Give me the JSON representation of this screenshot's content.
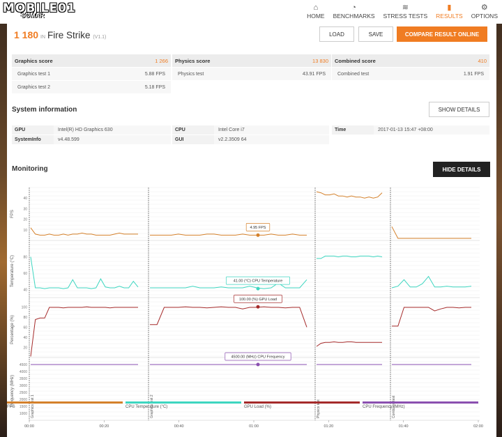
{
  "brand": {
    "logo": "MOBILE",
    "logo_sub": "01",
    "logo_sub2": "SOMAR"
  },
  "nav": [
    {
      "icon": "home-icon",
      "glyph": "⌂",
      "label": "HOME",
      "active": false
    },
    {
      "icon": "gauge-icon",
      "glyph": "◔",
      "label": "BENCHMARKS",
      "active": false
    },
    {
      "icon": "stress-icon",
      "glyph": "≋",
      "label": "STRESS TESTS",
      "active": false
    },
    {
      "icon": "bar-chart-icon",
      "glyph": "▮",
      "label": "RESULTS",
      "active": true
    },
    {
      "icon": "gear-icon",
      "glyph": "⚙",
      "label": "OPTIONS",
      "active": false
    }
  ],
  "result": {
    "score": "1 180",
    "in": "IN",
    "test": "Fire Strike",
    "version": "(V1.1)"
  },
  "buttons": {
    "load": "LOAD",
    "save": "SAVE",
    "compare": "COMPARE RESULT ONLINE",
    "show_details": "SHOW DETAILS",
    "hide_details": "HIDE DETAILS"
  },
  "scores": [
    {
      "title": "Graphics score",
      "value": "1 266",
      "rows": [
        {
          "k": "Graphics test 1",
          "v": "5.88 FPS"
        },
        {
          "k": "Graphics test 2",
          "v": "5.18 FPS"
        }
      ]
    },
    {
      "title": "Physics score",
      "value": "13 830",
      "rows": [
        {
          "k": "Physics test",
          "v": "43.91 FPS"
        }
      ]
    },
    {
      "title": "Combined score",
      "value": "410",
      "rows": [
        {
          "k": "Combined test",
          "v": "1.91 FPS"
        }
      ]
    }
  ],
  "system": {
    "title": "System information",
    "gpu_label": "GPU",
    "gpu": "Intel(R) HD Graphics 630",
    "sysinfo_label": "SystemInfo",
    "sysinfo": "v4.48.599",
    "cpu_label": "CPU",
    "cpu": "Intel Core i7",
    "gui_label": "GUI",
    "gui": "v2.2.3509 64",
    "time_label": "Time",
    "time": "2017-01-13 15:47 +08:00"
  },
  "monitoring": {
    "title": "Monitoring"
  },
  "colors": {
    "accent": "#f07c22",
    "fps": "#d4802a",
    "temp": "#3dd6c0",
    "gpu": "#a52a2a",
    "freq": "#8a4fb0"
  },
  "chart_data": {
    "type": "line",
    "x_ticks": [
      "00:00",
      "00:20",
      "00:40",
      "01:00",
      "01:20",
      "01:40",
      "02:00"
    ],
    "segment_labels": [
      "Graphics test 1",
      "Graphics test 2",
      "Physics test",
      "Combined test"
    ],
    "series": [
      {
        "name": "FPS",
        "ylabel": "FPS",
        "yticks": [
          "10",
          "20",
          "30",
          "40"
        ],
        "ylim": [
          0,
          50
        ],
        "tooltip": "4.95 FPS",
        "values": [
          [
            12,
            6,
            5,
            5,
            6,
            5,
            5,
            6,
            5,
            6,
            6,
            7,
            6,
            6,
            5,
            5,
            5,
            5,
            6,
            7,
            6,
            6,
            6,
            6
          ],
          [
            5,
            5,
            5,
            5,
            6,
            5,
            5,
            5,
            6,
            6,
            5,
            5,
            5,
            6,
            5,
            5,
            5,
            6,
            5,
            5,
            6,
            5,
            5
          ],
          [
            46,
            45,
            43,
            43,
            44,
            42,
            42,
            41,
            42,
            41,
            41,
            40,
            41,
            40,
            41,
            45
          ],
          [
            13,
            2,
            2,
            2,
            2,
            2,
            2,
            2,
            2,
            2,
            2,
            2,
            2,
            2
          ]
        ]
      },
      {
        "name": "CPU Temperature (°C)",
        "ylabel": "Temperature (°C)",
        "yticks": [
          "40",
          "60",
          "80"
        ],
        "ylim": [
          30,
          95
        ],
        "tooltip": "41.00 (°C) CPU Temperature",
        "values": [
          [
            80,
            42,
            42,
            41,
            42,
            42,
            42,
            41,
            42,
            52,
            42,
            42,
            42,
            41,
            42,
            53,
            43,
            42,
            42,
            44,
            42,
            42,
            50,
            43
          ],
          [
            42,
            42,
            42,
            42,
            42,
            42,
            44,
            42,
            42,
            42,
            43,
            42,
            42,
            42,
            44,
            42,
            41,
            42,
            48,
            42,
            42,
            42,
            52
          ],
          [
            78,
            78,
            81,
            81,
            81,
            80,
            81,
            81,
            80,
            80,
            81,
            81,
            81,
            80,
            81,
            80
          ],
          [
            42,
            44,
            52,
            43,
            43,
            47,
            56,
            43,
            43,
            44,
            43,
            43,
            43,
            44
          ]
        ]
      },
      {
        "name": "GPU Load (%)",
        "ylabel": "Percentage (%)",
        "yticks": [
          "20",
          "40",
          "60",
          "80",
          "100"
        ],
        "ylim": [
          0,
          110
        ],
        "tooltip": "100.00 (%) GPU Load",
        "values": [
          [
            2,
            75,
            78,
            78,
            99,
            99,
            99,
            98,
            99,
            99,
            99,
            99,
            100,
            99,
            99,
            99,
            99,
            98,
            99,
            99,
            99,
            99,
            99,
            99
          ],
          [
            65,
            65,
            99,
            99,
            99,
            100,
            99,
            99,
            98,
            99,
            100,
            99,
            99,
            96,
            99,
            99,
            100,
            99,
            99,
            98,
            99,
            99,
            60
          ],
          [
            22,
            28,
            30,
            30,
            31,
            30,
            30,
            31,
            31,
            30,
            30,
            30,
            30,
            30,
            30,
            30
          ],
          [
            62,
            62,
            99,
            99,
            99,
            99,
            99,
            92,
            96,
            99,
            99,
            98,
            99,
            99
          ]
        ]
      },
      {
        "name": "CPU Frequency (MHz)",
        "ylabel": "Frequency (MHz)",
        "yticks": [
          "1000",
          "1500",
          "2000",
          "2500",
          "3000",
          "3500",
          "4000",
          "4500"
        ],
        "ylim": [
          500,
          4700
        ],
        "tooltip": "4500.00 (MHz) CPU Frequency",
        "values": [
          [
            4500,
            4500,
            4500,
            4500,
            4500,
            4500,
            4500,
            4500,
            4500,
            4500,
            4500,
            4500,
            4500,
            4500,
            4500,
            4500,
            4500,
            4500,
            4500,
            4500,
            4500,
            4500,
            4500,
            4500
          ],
          [
            4500,
            4500,
            4500,
            4500,
            4500,
            4500,
            4500,
            4500,
            4500,
            4500,
            4500,
            4500,
            4500,
            4500,
            4500,
            4500,
            4500,
            4500,
            4500,
            4500,
            4500,
            4500,
            4500
          ],
          [
            4500,
            4500,
            4500,
            4500,
            4500,
            4500,
            4500,
            4500,
            4500,
            4500,
            4500,
            4500,
            4500,
            4500,
            4500,
            4500
          ],
          [
            4500,
            4500,
            4500,
            4500,
            4500,
            4500,
            4500,
            4500,
            4500,
            4500,
            4500,
            4500,
            4500,
            4500
          ]
        ]
      }
    ],
    "legend": [
      "FPS",
      "CPU Temperature (°C)",
      "GPU Load (%)",
      "CPU Frequency (MHz)"
    ]
  }
}
